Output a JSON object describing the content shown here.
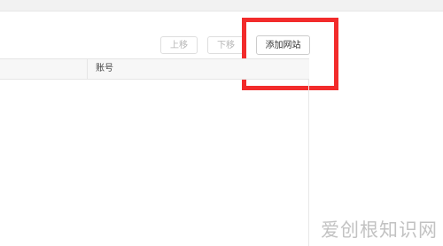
{
  "toolbar": {
    "move_up_label": "上移",
    "move_down_label": "下移",
    "add_site_label": "添加网站"
  },
  "table": {
    "columns": [
      "",
      "账号"
    ]
  },
  "watermark": {
    "text": "爱创根知识网"
  },
  "colors": {
    "highlight_border": "#f22b2b",
    "header_background": "#f7f7f7",
    "disabled_text": "#b5b5b5"
  }
}
